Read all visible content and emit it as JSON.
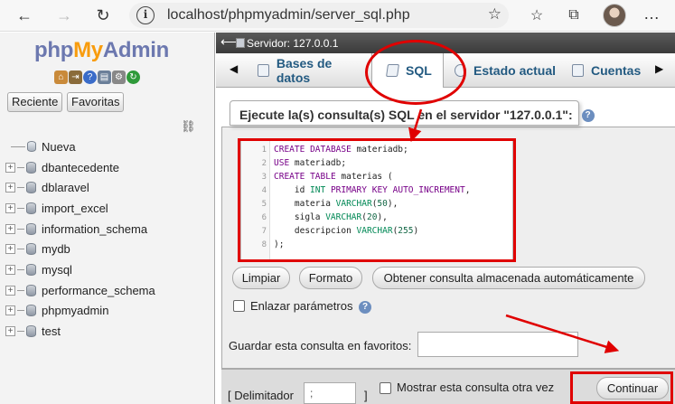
{
  "browser": {
    "url": "localhost/phpmyadmin/server_sql.php"
  },
  "sidebar": {
    "logo": {
      "php": "php",
      "my": "My",
      "admin": "Admin"
    },
    "recent_label": "Reciente",
    "favorites_label": "Favoritas",
    "tree": [
      {
        "name": "Nueva",
        "type": "new"
      },
      {
        "name": "dbantecedente",
        "type": "db"
      },
      {
        "name": "dblaravel",
        "type": "db"
      },
      {
        "name": "import_excel",
        "type": "db"
      },
      {
        "name": "information_schema",
        "type": "db"
      },
      {
        "name": "mydb",
        "type": "db"
      },
      {
        "name": "mysql",
        "type": "db"
      },
      {
        "name": "performance_schema",
        "type": "db"
      },
      {
        "name": "phpmyadmin",
        "type": "db"
      },
      {
        "name": "test",
        "type": "db"
      }
    ]
  },
  "header": {
    "server_label": "Servidor: 127.0.0.1"
  },
  "tabs": {
    "databases": "Bases de datos",
    "sql": "SQL",
    "status": "Estado actual",
    "accounts": "Cuentas"
  },
  "main": {
    "legend": "Ejecute la(s) consulta(s) SQL en el servidor \"127.0.0.1\":",
    "code_lines": [
      "CREATE DATABASE materiadb;",
      "USE materiadb;",
      "CREATE TABLE materias (",
      "    id INT PRIMARY KEY AUTO_INCREMENT,",
      "    materia VARCHAR(50),",
      "    sigla VARCHAR(20),",
      "    descripcion VARCHAR(255)",
      ");"
    ],
    "buttons": {
      "clear": "Limpiar",
      "format": "Formato",
      "get_saved": "Obtener consulta almacenada automáticamente"
    },
    "bind_params_label": "Enlazar parámetros",
    "bookmark_label": "Guardar esta consulta en favoritos:",
    "bookmark_value": ""
  },
  "footer": {
    "delimiter_label": "[ Delimitador",
    "delimiter_value": ";",
    "delimiter_end": "]",
    "show_again_label": "Mostrar esta consulta otra vez",
    "go_label": "Continuar"
  },
  "colors": {
    "annotation": "#e00000",
    "tab_text": "#235a81"
  }
}
